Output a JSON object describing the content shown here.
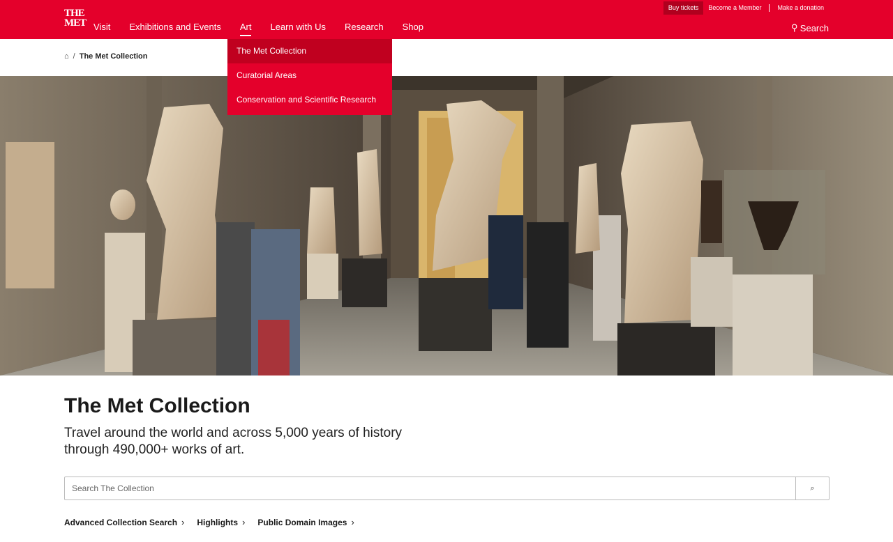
{
  "header": {
    "logo_line1": "THE",
    "logo_line2": "MET",
    "nav": [
      "Visit",
      "Exhibitions and Events",
      "Art",
      "Learn with Us",
      "Research",
      "Shop"
    ],
    "utility": [
      "Buy tickets",
      "Become a Member",
      "Make a donation"
    ],
    "search_label": "Search",
    "search_icon": "search-icon"
  },
  "dropdown": {
    "items": [
      "The Met Collection",
      "Curatorial Areas",
      "Conservation and Scientific Research"
    ]
  },
  "breadcrumb": {
    "home_icon": "home-icon",
    "separator": "/",
    "current": "The Met Collection"
  },
  "main": {
    "title": "The Met Collection",
    "subtitle": "Travel around the world and across 5,000 years of history through 490,000+ works of art.",
    "search_placeholder": "Search The Collection",
    "links": [
      "Advanced Collection Search",
      "Highlights",
      "Public Domain Images"
    ]
  },
  "colors": {
    "brand_red": "#e4002b",
    "dark_red": "#b0001e"
  }
}
